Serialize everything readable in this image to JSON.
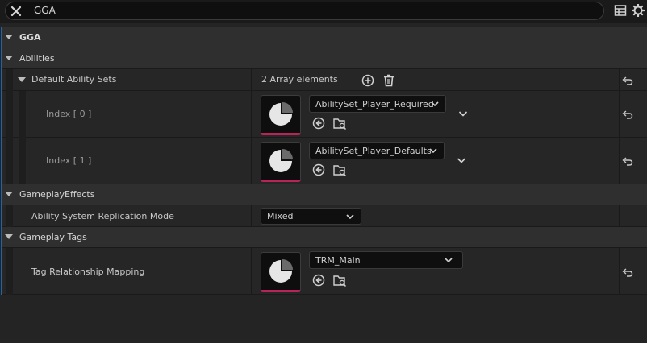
{
  "search": {
    "value": "GGA"
  },
  "categories": {
    "root": "GGA",
    "abilities": "Abilities",
    "gameplay_effects": "GameplayEffects",
    "gameplay_tags": "Gameplay Tags"
  },
  "default_ability_sets": {
    "label": "Default Ability Sets",
    "count_text": "2 Array elements",
    "items": [
      {
        "label": "Index [ 0 ]",
        "asset": "AbilitySet_Player_Required"
      },
      {
        "label": "Index [ 1 ]",
        "asset": "AbilitySet_Player_Defaults"
      }
    ]
  },
  "replication_mode": {
    "label": "Ability System Replication Mode",
    "value": "Mixed"
  },
  "tag_mapping": {
    "label": "Tag Relationship Mapping",
    "asset": "TRM_Main"
  },
  "colors": {
    "accent_border": "#2563a8",
    "thumb_underline": "#b8245a"
  }
}
